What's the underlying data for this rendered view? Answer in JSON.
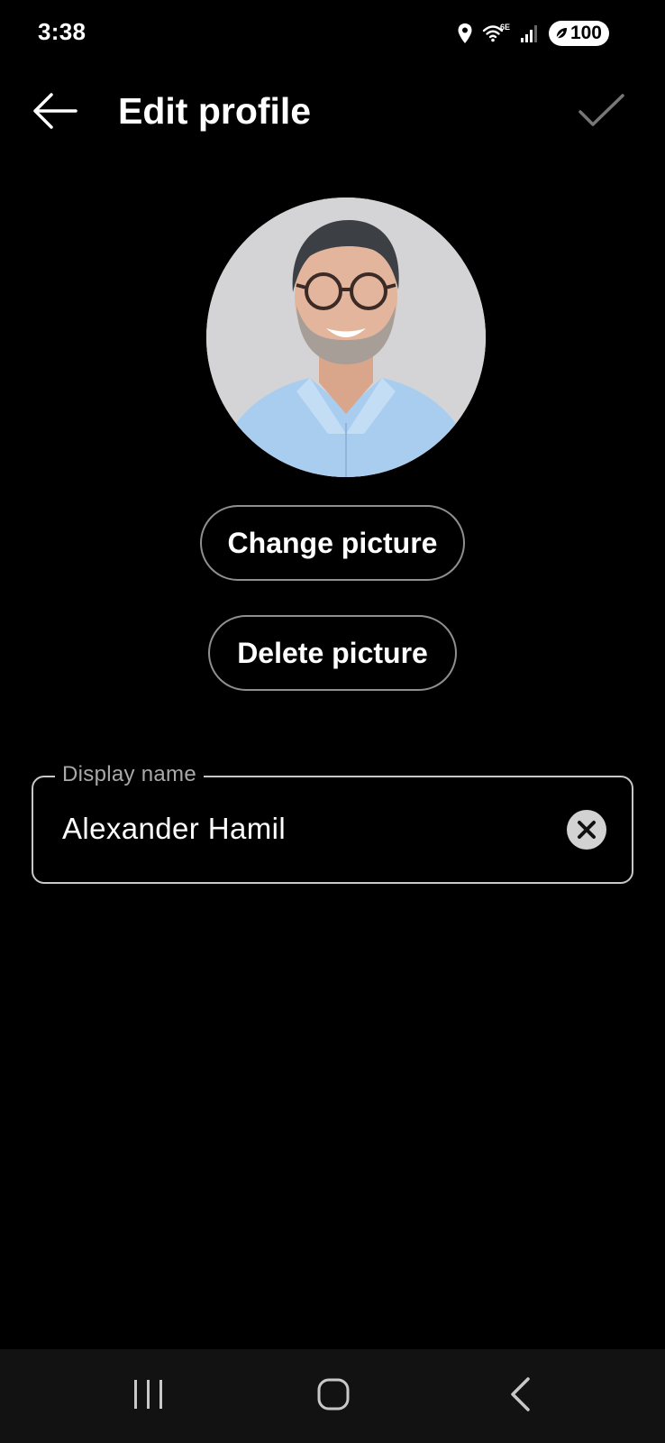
{
  "status_bar": {
    "time": "3:38",
    "battery": "100",
    "wifi_label": "6E",
    "icons": [
      "location-icon",
      "wifi-6e-icon",
      "signal-icon",
      "battery-saver-icon"
    ]
  },
  "header": {
    "title": "Edit profile",
    "back_icon": "arrow-left-icon",
    "save_icon": "checkmark-icon"
  },
  "avatar": {
    "alt": "Profile picture"
  },
  "actions": {
    "change_picture": "Change picture",
    "delete_picture": "Delete picture"
  },
  "display_name_field": {
    "label": "Display name",
    "value": "Alexander Hamil",
    "clear_icon": "clear-icon"
  },
  "nav_bar": {
    "items": [
      "recents-icon",
      "home-icon",
      "back-icon"
    ]
  },
  "colors": {
    "background": "#000000",
    "text": "#ffffff",
    "outline": "#8f8f8f",
    "label": "#a9a9a9",
    "nav_background": "#121212"
  }
}
